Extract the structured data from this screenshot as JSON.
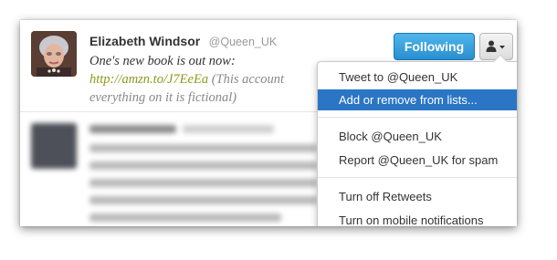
{
  "tweet": {
    "author_name": "Elizabeth Windsor",
    "author_handle": "@Queen_UK",
    "text_line1": "One's new book is out now:",
    "link": "http://amzn.to/J7EeEa",
    "text_after_link": " (This account",
    "text_line3": "everything on it is fictional)"
  },
  "actions": {
    "follow_label": "Following",
    "user_menu_icon": "user-dropdown-icon"
  },
  "menu": {
    "items": [
      {
        "label": "Tweet to @Queen_UK",
        "active": false
      },
      {
        "label": "Add or remove from lists...",
        "active": true
      },
      {
        "label": "Block @Queen_UK",
        "active": false
      },
      {
        "label": "Report @Queen_UK for spam",
        "active": false
      },
      {
        "label": "Turn off Retweets",
        "active": false
      },
      {
        "label": "Turn on mobile notifications",
        "active": false
      }
    ]
  },
  "colors": {
    "follow_button": "#2a8fd1",
    "menu_highlight": "#2a76c5",
    "link": "#8a9a1a"
  }
}
